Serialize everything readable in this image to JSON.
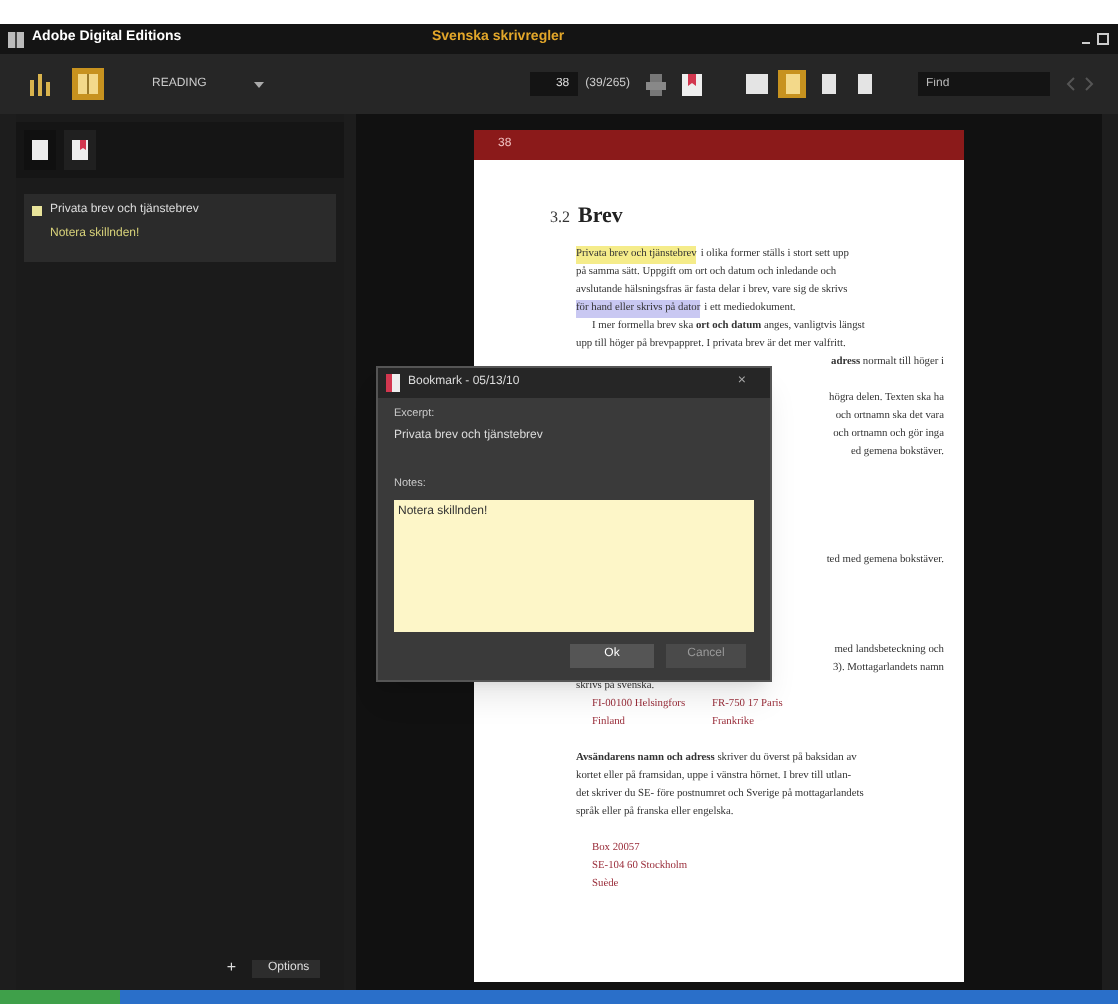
{
  "window": {
    "app_title": "Adobe Digital Editions",
    "document_title": "Svenska skrivregler"
  },
  "toolbar": {
    "views": [
      {
        "kind": "library",
        "selected": false
      },
      {
        "kind": "reading",
        "selected": true
      }
    ],
    "mode": "READING",
    "page_input": "38",
    "page_count": "(39/265)",
    "layouts": [
      {
        "kind": "single",
        "selected": false
      },
      {
        "kind": "fit",
        "selected": true
      },
      {
        "kind": "narrow",
        "selected": false
      },
      {
        "kind": "doc",
        "selected": false
      }
    ],
    "find": {
      "placeholder": "Find"
    }
  },
  "sidebar": {
    "tabs": [
      {
        "kind": "contents",
        "selected": false
      },
      {
        "kind": "bookmarks",
        "selected": true
      }
    ],
    "bookmarks": [
      {
        "title": "Privata brev och tjänstebrev",
        "note": "Notera skillnden!",
        "color": "#e8e39a"
      }
    ],
    "add": "+",
    "options": "Options"
  },
  "page": {
    "number": "38",
    "heading_number": "3.2",
    "heading": "Brev",
    "blocks": [
      {
        "kind": "line",
        "highlight": "Privata brev och tjänstebrev",
        "color": "#f5ec8a",
        "text": "i olika former ställs i stort sett upp"
      },
      {
        "kind": "line",
        "text": "på samma sätt. Uppgift om ort och datum och inledande och"
      },
      {
        "kind": "line",
        "text": "avslutande hälsningsfras är fasta delar i brev, vare sig de skrivs"
      },
      {
        "kind": "line",
        "highlight": "för hand eller skrivs på dator",
        "color": "#c9c8f2",
        "text": "i ett mediedokument."
      },
      {
        "kind": "indent",
        "text": "I mer formella brev ska **ort och datum** anges, vanligtvis längst"
      },
      {
        "kind": "line",
        "text": "upp till höger på brevpappret. I privata brev är det mer valfritt."
      },
      {
        "kind": "partial",
        "text": "**adress** normalt till höger i"
      },
      {
        "kind": "gap"
      },
      {
        "kind": "partial",
        "text": "högra delen. Texten ska ha"
      },
      {
        "kind": "partial",
        "text": "och ortnamn ska det vara"
      },
      {
        "kind": "partial",
        "text": "och ortnamn och gör inga"
      },
      {
        "kind": "partial",
        "text": "ed gemena bokstäver."
      },
      {
        "kind": "gap"
      },
      {
        "kind": "gap"
      },
      {
        "kind": "gap"
      },
      {
        "kind": "gap"
      },
      {
        "kind": "gap"
      },
      {
        "kind": "partial",
        "text": "ted med gemena bokstäver."
      },
      {
        "kind": "gap"
      },
      {
        "kind": "gap"
      },
      {
        "kind": "gap"
      },
      {
        "kind": "gap"
      },
      {
        "kind": "partial",
        "text": "med landsbeteckning och"
      },
      {
        "kind": "partial",
        "text": "3). Mottagarlandets namn"
      },
      {
        "kind": "line",
        "text": "skrivs på svenska."
      },
      {
        "kind": "address",
        "text": "FI-00100 Helsingfors",
        "text2": "FR-750 17 Paris"
      },
      {
        "kind": "address",
        "text": "Finland",
        "text2": "Frankrike"
      },
      {
        "kind": "gap"
      },
      {
        "kind": "line",
        "text": "**Avsändarens namn och adress** skriver du överst på baksidan av"
      },
      {
        "kind": "line",
        "text": "kortet eller på framsidan, uppe i vänstra hörnet. I brev till utlan-"
      },
      {
        "kind": "line",
        "text": "det skriver du SE- före postnumret och Sverige på mottagarlandets"
      },
      {
        "kind": "line",
        "text": "språk eller på franska eller engelska."
      },
      {
        "kind": "gap"
      },
      {
        "kind": "address",
        "text": "Box 20057"
      },
      {
        "kind": "address",
        "text": "SE-104 60 Stockholm"
      },
      {
        "kind": "address",
        "text": "Suède"
      }
    ]
  },
  "dialog": {
    "title": "Bookmark - 05/13/10",
    "close": "×",
    "excerpt_label": "Excerpt:",
    "excerpt": "Privata brev och tjänstebrev",
    "notes_label": "Notes:",
    "notes": "Notera skillnden!",
    "ok": "Ok",
    "cancel": "Cancel"
  }
}
